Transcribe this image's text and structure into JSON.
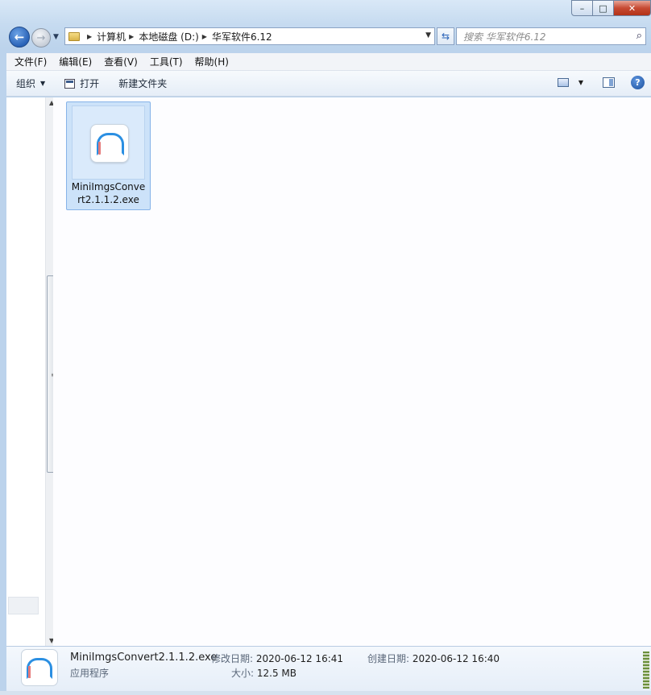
{
  "window": {
    "controls": {
      "minimize": "–",
      "maximize": "□",
      "close": "✕"
    }
  },
  "address": {
    "breadcrumbs": [
      "计算机",
      "本地磁盘 (D:)",
      "华军软件6.12"
    ],
    "search_placeholder": "搜索 华军软件6.12"
  },
  "menu": [
    "文件(F)",
    "编辑(E)",
    "查看(V)",
    "工具(T)",
    "帮助(H)"
  ],
  "toolbar": {
    "organize": "组织",
    "open": "打开",
    "new_folder": "新建文件夹",
    "help": "?"
  },
  "files": [
    {
      "name": "MiniImgsConvert2.1.1.2.exe",
      "selected": true,
      "icon": "app-icon"
    }
  ],
  "details": {
    "name": "MiniImgsConvert2.1.1.2.exe",
    "type": "应用程序",
    "modified_label": "修改日期:",
    "modified_value": "2020-06-12 16:41",
    "size_label": "大小:",
    "size_value": "12.5 MB",
    "created_label": "创建日期:",
    "created_value": "2020-06-12 16:40"
  },
  "colors": {
    "selection": "#cce2f9",
    "accent": "#2b8fe2",
    "close_button": "#c74a32"
  }
}
